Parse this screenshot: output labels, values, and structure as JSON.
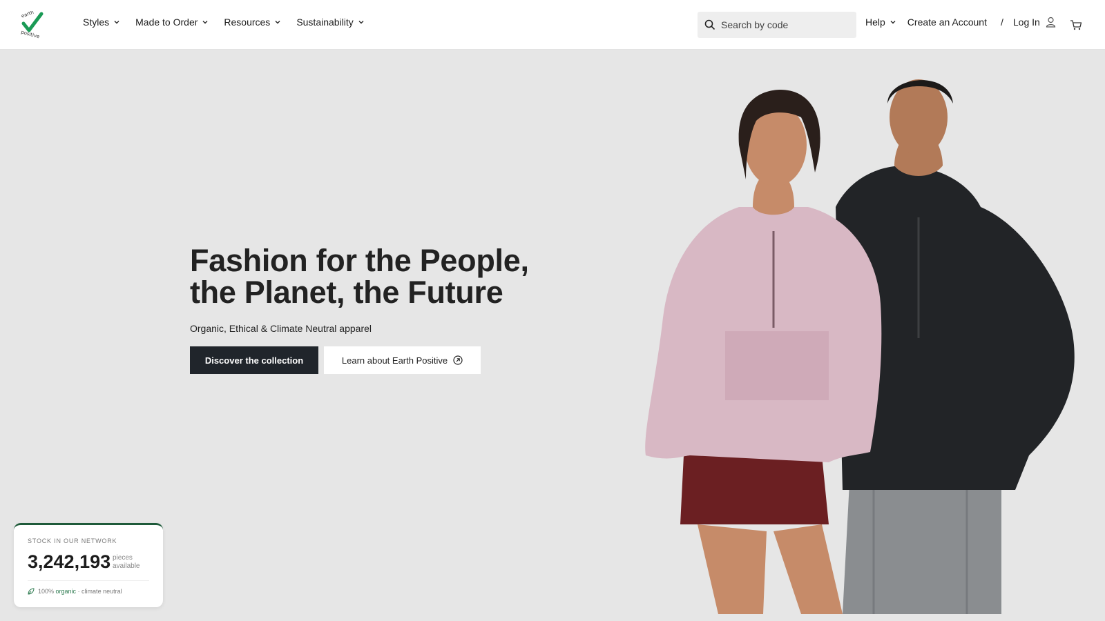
{
  "brand": {
    "logo_text": "earth positive",
    "logo_color": "#1a9a55"
  },
  "nav": {
    "items": [
      {
        "label": "Styles"
      },
      {
        "label": "Made to Order"
      },
      {
        "label": "Resources"
      },
      {
        "label": "Sustainability"
      }
    ]
  },
  "search": {
    "placeholder": "Search by code",
    "icon": "search-icon"
  },
  "account": {
    "help_label": "Help",
    "create_label": "Create an Account",
    "separator": "/",
    "login_label": "Log In",
    "user_icon": "user-icon",
    "cart_icon": "cart-icon"
  },
  "hero": {
    "title_line1": "Fashion for the People,",
    "title_line2": "the Planet, the Future",
    "subtitle": "Organic, Ethical & Climate Neutral apparel",
    "primary_cta": "Discover the collection",
    "secondary_cta": "Learn about Earth Positive",
    "secondary_icon": "arrow-up-right-circle-icon"
  },
  "stock": {
    "label": "STOCK IN OUR NETWORK",
    "count": "3,242,193",
    "unit_line1": "pieces",
    "unit_line2": "available",
    "foot_prefix": "100% ",
    "foot_highlight": "organic",
    "foot_suffix": " · climate neutral",
    "accent_color": "#1e5a3a"
  },
  "colors": {
    "background": "#e6e6e6",
    "primary_button": "#20252b",
    "pink_hoodie": "#d8b8c4",
    "black_hoodie": "#222427",
    "skirt": "#6b1f22",
    "jeans": "#8a8d90"
  }
}
